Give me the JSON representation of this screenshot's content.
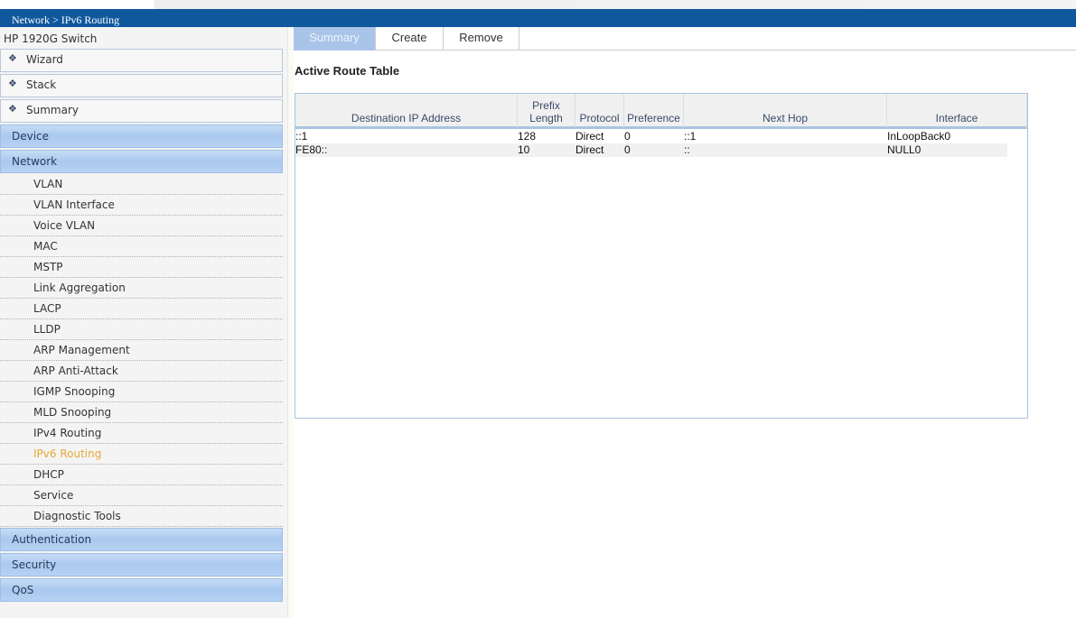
{
  "breadcrumb": "Network > IPv6 Routing",
  "device_name": "HP 1920G Switch",
  "sidebar": {
    "top_items": [
      {
        "label": "Wizard"
      },
      {
        "label": "Stack"
      },
      {
        "label": "Summary"
      }
    ],
    "categories": [
      {
        "label": "Device"
      },
      {
        "label": "Network"
      }
    ],
    "network_items": [
      {
        "label": "VLAN"
      },
      {
        "label": "VLAN Interface"
      },
      {
        "label": "Voice VLAN"
      },
      {
        "label": "MAC"
      },
      {
        "label": "MSTP"
      },
      {
        "label": "Link Aggregation"
      },
      {
        "label": "LACP"
      },
      {
        "label": "LLDP"
      },
      {
        "label": "ARP Management"
      },
      {
        "label": "ARP Anti-Attack"
      },
      {
        "label": "IGMP Snooping"
      },
      {
        "label": "MLD Snooping"
      },
      {
        "label": "IPv4 Routing"
      },
      {
        "label": "IPv6 Routing",
        "active": true
      },
      {
        "label": "DHCP"
      },
      {
        "label": "Service"
      },
      {
        "label": "Diagnostic Tools"
      }
    ],
    "bottom_categories": [
      {
        "label": "Authentication"
      },
      {
        "label": "Security"
      },
      {
        "label": "QoS"
      }
    ]
  },
  "tabs": [
    {
      "label": "Summary",
      "selected": true
    },
    {
      "label": "Create"
    },
    {
      "label": "Remove"
    }
  ],
  "section_title": "Active Route Table",
  "table": {
    "headers": [
      "Destination IP Address",
      "Prefix Length",
      "Protocol",
      "Preference",
      "Next Hop",
      "Interface"
    ],
    "rows": [
      [
        "::1",
        "128",
        "Direct",
        "0",
        "::1",
        "InLoopBack0"
      ],
      [
        "FE80::",
        "10",
        "Direct",
        "0",
        "::",
        "NULL0"
      ]
    ]
  },
  "colors": {
    "header_bar": "#10589e",
    "active_item": "#e8a93a",
    "selected_tab": "#a8c4e8"
  }
}
